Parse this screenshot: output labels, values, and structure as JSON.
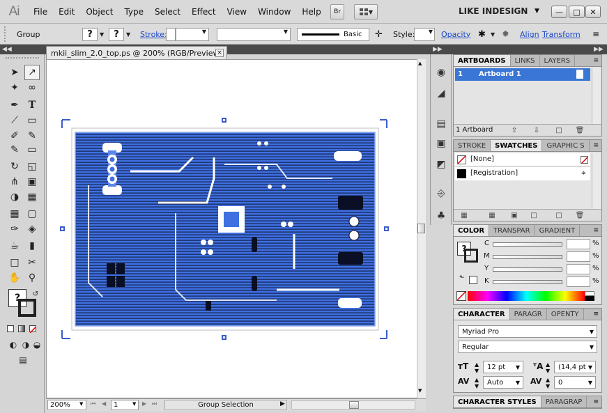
{
  "app": {
    "logo": "Ai",
    "bridge_label": "Br",
    "workspace": "LIKE INDESIGN"
  },
  "menu": [
    "File",
    "Edit",
    "Object",
    "Type",
    "Select",
    "Effect",
    "View",
    "Window",
    "Help"
  ],
  "control_bar": {
    "selection_label": "Group",
    "fill_swatch": "?",
    "stroke_swatch": "?",
    "stroke_label": "Stroke:",
    "brush_label": "Basic",
    "style_label": "Style:",
    "opacity_label": "Opacity",
    "align_label": "Align",
    "transform_label": "Transform"
  },
  "document": {
    "tab_title": "mkii_slim_2.0_top.ps @ 200% (RGB/Preview)",
    "close_glyph": "×",
    "zoom": "200%",
    "artboard_number": "1",
    "status": "Group Selection",
    "artwork_color": "#3f6fe0"
  },
  "artboards_panel": {
    "tabs": [
      "ARTBOARDS",
      "LINKS",
      "LAYERS"
    ],
    "rows": [
      {
        "index": "1",
        "name": "Artboard 1"
      }
    ],
    "footer_count": "1 Artboard"
  },
  "swatches_panel": {
    "tabs": [
      "STROKE",
      "SWATCHES",
      "GRAPHIC S"
    ],
    "rows": [
      {
        "name": "[None]"
      },
      {
        "name": "[Registration]"
      }
    ]
  },
  "color_panel": {
    "tabs": [
      "COLOR",
      "TRANSPAR",
      "GRADIENT"
    ],
    "channels": [
      {
        "label": "C",
        "unit": "%"
      },
      {
        "label": "M",
        "unit": "%"
      },
      {
        "label": "Y",
        "unit": "%"
      },
      {
        "label": "K",
        "unit": "%"
      }
    ],
    "swatch_mark": "?"
  },
  "character_panel": {
    "tabs": [
      "CHARACTER",
      "PARAGR",
      "OPENTY"
    ],
    "font_family": "Myriad Pro",
    "font_style": "Regular",
    "font_size": "12 pt",
    "leading": "(14,4 pt",
    "kerning": "Auto",
    "tracking": "0"
  },
  "bottom_panel": {
    "tabs": [
      "CHARACTER STYLES",
      "PARAGRAP"
    ]
  }
}
